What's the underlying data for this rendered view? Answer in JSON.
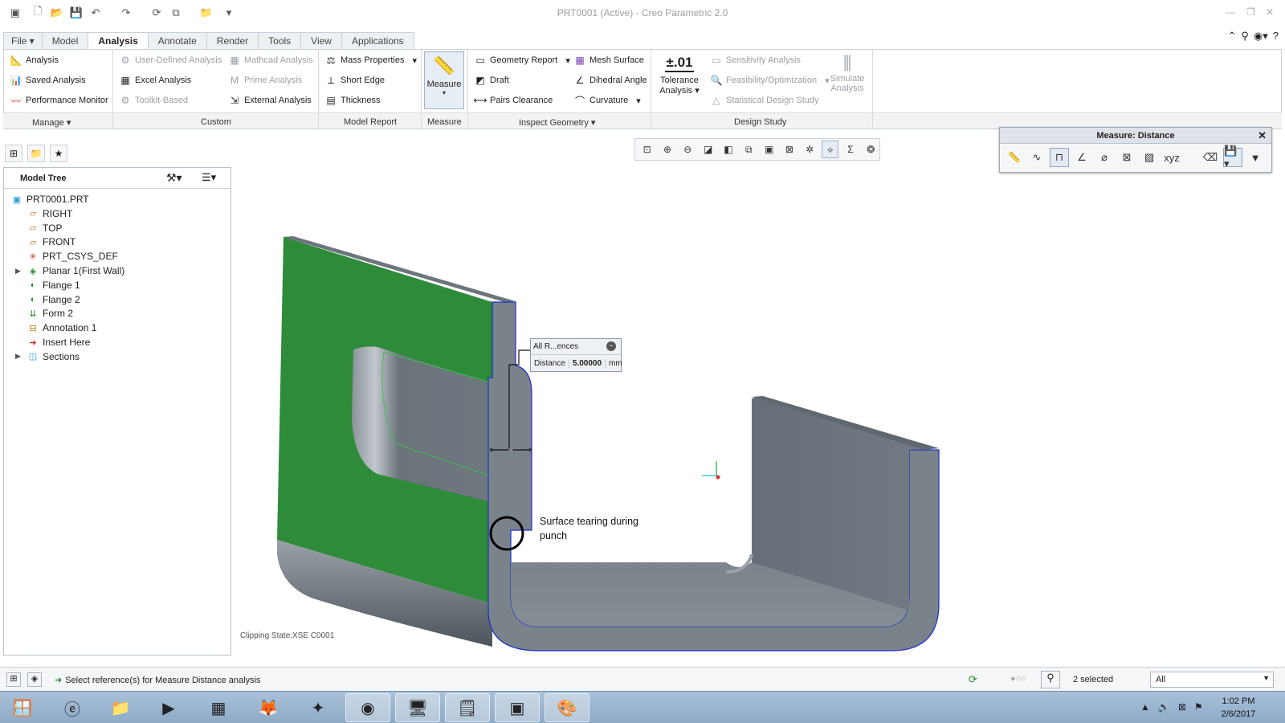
{
  "window": {
    "title": "PRT0001 (Active) - Creo Parametric 2.0"
  },
  "tabs": [
    {
      "label": "File",
      "has_dropdown": true
    },
    {
      "label": "Model"
    },
    {
      "label": "Analysis",
      "active": true
    },
    {
      "label": "Annotate"
    },
    {
      "label": "Render"
    },
    {
      "label": "Tools"
    },
    {
      "label": "View"
    },
    {
      "label": "Applications"
    }
  ],
  "ribbon": {
    "manage": {
      "label": "Manage",
      "analysis": "Analysis",
      "saved_analysis": "Saved Analysis",
      "performance_monitor": "Performance Monitor"
    },
    "custom": {
      "label": "Custom",
      "user_defined": "User-Defined Analysis",
      "excel": "Excel Analysis",
      "toolkit": "Toolkit-Based",
      "mathcad": "Mathcad Analysis",
      "prime": "Prime Analysis",
      "external": "External Analysis"
    },
    "model_report": {
      "label": "Model Report",
      "mass_properties": "Mass Properties",
      "short_edge": "Short Edge",
      "thickness": "Thickness"
    },
    "measure": {
      "label": "Measure",
      "button": "Measure"
    },
    "inspect_geometry": {
      "label": "Inspect Geometry",
      "geometry_report": "Geometry Report",
      "draft": "Draft",
      "pairs_clearance": "Pairs Clearance",
      "mesh_surface": "Mesh Surface",
      "dihedral_angle": "Dihedral Angle",
      "curvature": "Curvature"
    },
    "tolerance": {
      "icon_text": "±.01",
      "line1": "Tolerance",
      "line2": "Analysis"
    },
    "design_study": {
      "label": "Design Study",
      "sensitivity": "Sensitivity Analysis",
      "feasibility": "Feasibility/Optimization",
      "statistical": "Statistical Design Study",
      "simulate1": "Simulate",
      "simulate2": "Analysis"
    }
  },
  "model_tree": {
    "title": "Model Tree",
    "items": [
      {
        "label": "PRT0001.PRT",
        "icon": "part-icon",
        "level": 0
      },
      {
        "label": "RIGHT",
        "icon": "datum-plane-icon",
        "level": 1
      },
      {
        "label": "TOP",
        "icon": "datum-plane-icon",
        "level": 1
      },
      {
        "label": "FRONT",
        "icon": "datum-plane-icon",
        "level": 1
      },
      {
        "label": "PRT_CSYS_DEF",
        "icon": "csys-icon",
        "level": 1
      },
      {
        "label": "Planar 1(First Wall)",
        "icon": "planar-wall-icon",
        "level": 1,
        "expandable": true
      },
      {
        "label": "Flange 1",
        "icon": "flange-icon",
        "level": 1
      },
      {
        "label": "Flange 2",
        "icon": "flange-icon",
        "level": 1
      },
      {
        "label": "Form 2",
        "icon": "form-icon",
        "level": 1
      },
      {
        "label": "Annotation 1",
        "icon": "annotation-icon",
        "level": 1
      },
      {
        "label": "Insert Here",
        "icon": "insert-arrow-icon",
        "level": 1
      },
      {
        "label": "Sections",
        "icon": "sections-icon",
        "level": 1,
        "expandable": true
      }
    ]
  },
  "measure_dialog": {
    "title": "Measure: Distance"
  },
  "measure_callout": {
    "header": "All R...ences",
    "label": "Distance",
    "value": "5.00000",
    "unit": "mm"
  },
  "annotation": {
    "line1": "Surface tearing during",
    "line2": "punch"
  },
  "viewport": {
    "clipping_state": "Clipping State:XSE C0001"
  },
  "status": {
    "message": "Select reference(s) for Measure Distance analysis",
    "selected": "2 selected",
    "filter": "All"
  },
  "taskbar": {
    "time": "1:02 PM",
    "date": "2/6/2017"
  },
  "colors": {
    "face_green": "#2e8b3a",
    "body_gray": "#6f7780",
    "edge_blue": "#1a2ecc",
    "accent": "#1e5fa8"
  }
}
